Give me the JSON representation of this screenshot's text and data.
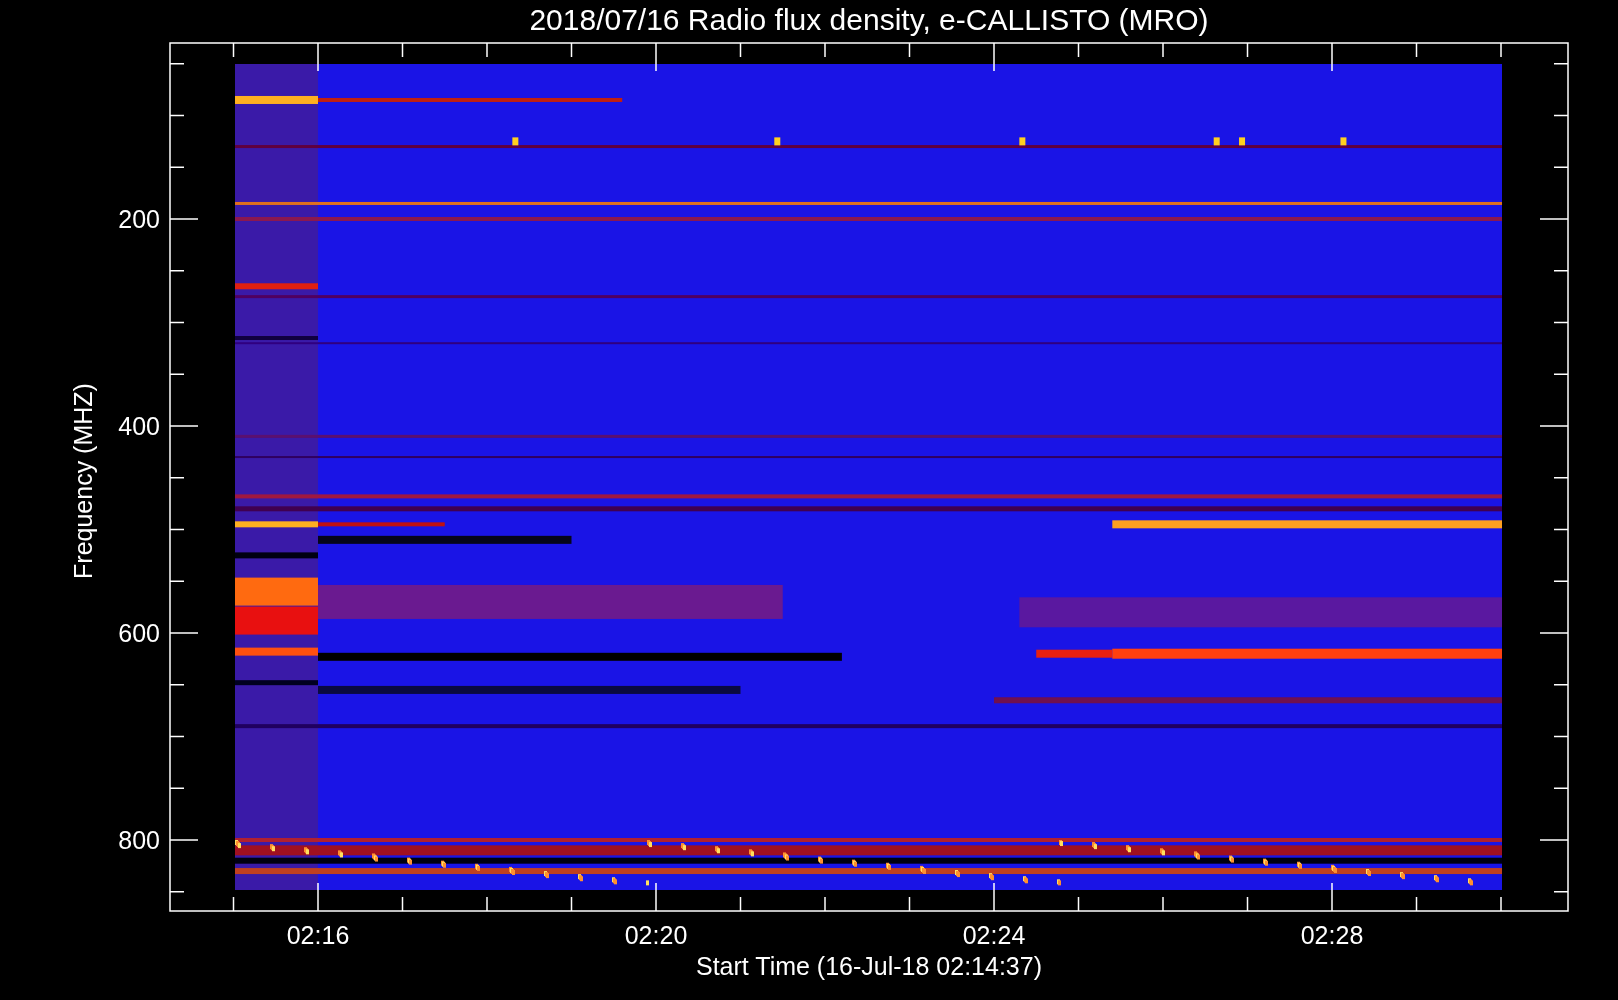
{
  "title": "2018/07/16  Radio flux density, e-CALLISTO (MRO)",
  "y_axis": {
    "label": "Frequency (MHZ)",
    "ticks": [
      "200",
      "400",
      "600",
      "800"
    ]
  },
  "x_axis": {
    "label": "Start Time (16-Jul-18 02:14:37)",
    "ticks": [
      "02:16",
      "02:20",
      "02:24",
      "02:28"
    ]
  }
}
